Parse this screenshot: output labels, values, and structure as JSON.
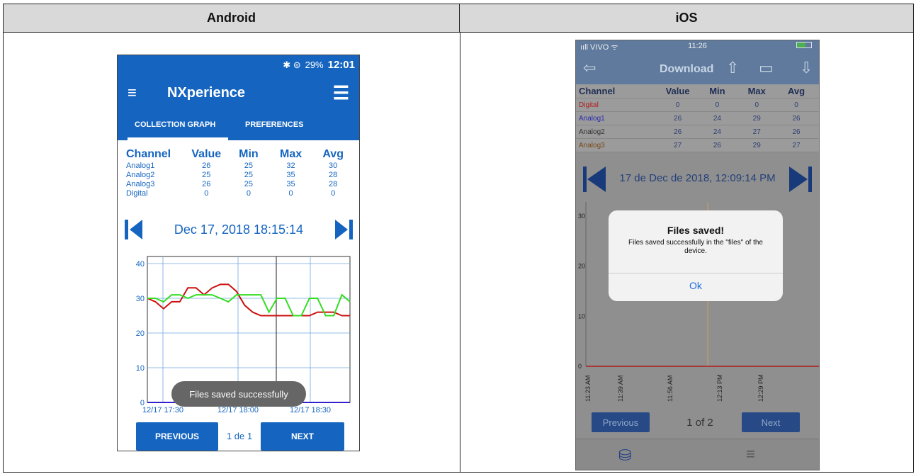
{
  "columns": {
    "left": "Android",
    "right": "iOS"
  },
  "android": {
    "status": {
      "signal": "✱ ⊜",
      "battery": "29%",
      "time": "12:01"
    },
    "app_title": "NXperience",
    "tabs": [
      "COLLECTION GRAPH",
      "PREFERENCES"
    ],
    "table": {
      "headers": [
        "Channel",
        "Value",
        "Min",
        "Max",
        "Avg"
      ],
      "rows": [
        [
          "Analog1",
          "26",
          "25",
          "32",
          "30"
        ],
        [
          "Analog2",
          "25",
          "25",
          "35",
          "28"
        ],
        [
          "Analog3",
          "26",
          "25",
          "35",
          "28"
        ],
        [
          "Digital",
          "0",
          "0",
          "0",
          "0"
        ]
      ]
    },
    "date": "Dec 17, 2018 18:15:14",
    "toast": "Files saved successfully",
    "buttons": {
      "previous": "PREVIOUS",
      "next": "NEXT"
    },
    "page": "1 de 1",
    "chart_data": {
      "type": "line",
      "y_ticks": [
        "40",
        "30",
        "20",
        "10",
        "0"
      ],
      "x_ticks": [
        "12/17 17:30",
        "12/17 18:00",
        "12/17 18:30"
      ],
      "ylim": [
        0,
        40
      ],
      "series": [
        {
          "color": "#cc1111",
          "values": [
            30,
            29,
            27,
            29,
            29,
            33,
            33,
            31,
            33,
            34,
            34,
            32,
            28,
            26,
            25,
            25,
            25,
            25,
            25,
            25,
            25,
            26,
            26,
            26,
            25,
            25
          ]
        },
        {
          "color": "#33dd22",
          "values": [
            30,
            30,
            29,
            31,
            31,
            30,
            31,
            31,
            31,
            30,
            29,
            31,
            31,
            31,
            31,
            26,
            30,
            30,
            25,
            25,
            30,
            30,
            25,
            25,
            31,
            29
          ]
        },
        {
          "color": "#3322cc",
          "values": [
            0,
            0,
            0,
            0,
            0,
            0,
            0,
            0,
            0,
            0,
            0,
            0,
            0,
            0,
            0,
            0,
            0,
            0,
            0,
            0,
            0,
            0,
            0,
            0,
            0,
            0
          ]
        }
      ]
    }
  },
  "ios": {
    "status": {
      "carrier": "ııll VIVO ᯤ",
      "time": "11:26"
    },
    "title": "Download",
    "table": {
      "headers": [
        "Channel",
        "Value",
        "Min",
        "Max",
        "Avg"
      ],
      "rows": [
        {
          "cells": [
            "Digital",
            "0",
            "0",
            "0",
            "0"
          ],
          "color": "#b01c1c"
        },
        {
          "cells": [
            "Analog1",
            "26",
            "24",
            "29",
            "26"
          ],
          "color": "#2a2ab0"
        },
        {
          "cells": [
            "Analog2",
            "26",
            "24",
            "27",
            "26"
          ],
          "color": "#333333"
        },
        {
          "cells": [
            "Analog3",
            "27",
            "26",
            "29",
            "27"
          ],
          "color": "#7a4a1a"
        }
      ]
    },
    "date": "17 de Dec de 2018, 12:09:14 PM",
    "alert": {
      "title": "Files saved!",
      "message": "Files saved successfully in the \"files\" of the device.",
      "ok": "Ok"
    },
    "buttons": {
      "previous": "Previous",
      "next": "Next"
    },
    "page": "1 of 2",
    "chart_data": {
      "type": "line",
      "y_ticks": [
        "30",
        "20",
        "10",
        "0"
      ],
      "x_ticks": [
        "11:23 AM",
        "11:39 AM",
        "11:56 AM",
        "12:13 PM",
        "12:29 PM"
      ],
      "ylim": [
        0,
        30
      ],
      "series": [
        {
          "color": "#b01c1c",
          "values": [
            0,
            0,
            0,
            0,
            0,
            0
          ]
        }
      ]
    }
  }
}
